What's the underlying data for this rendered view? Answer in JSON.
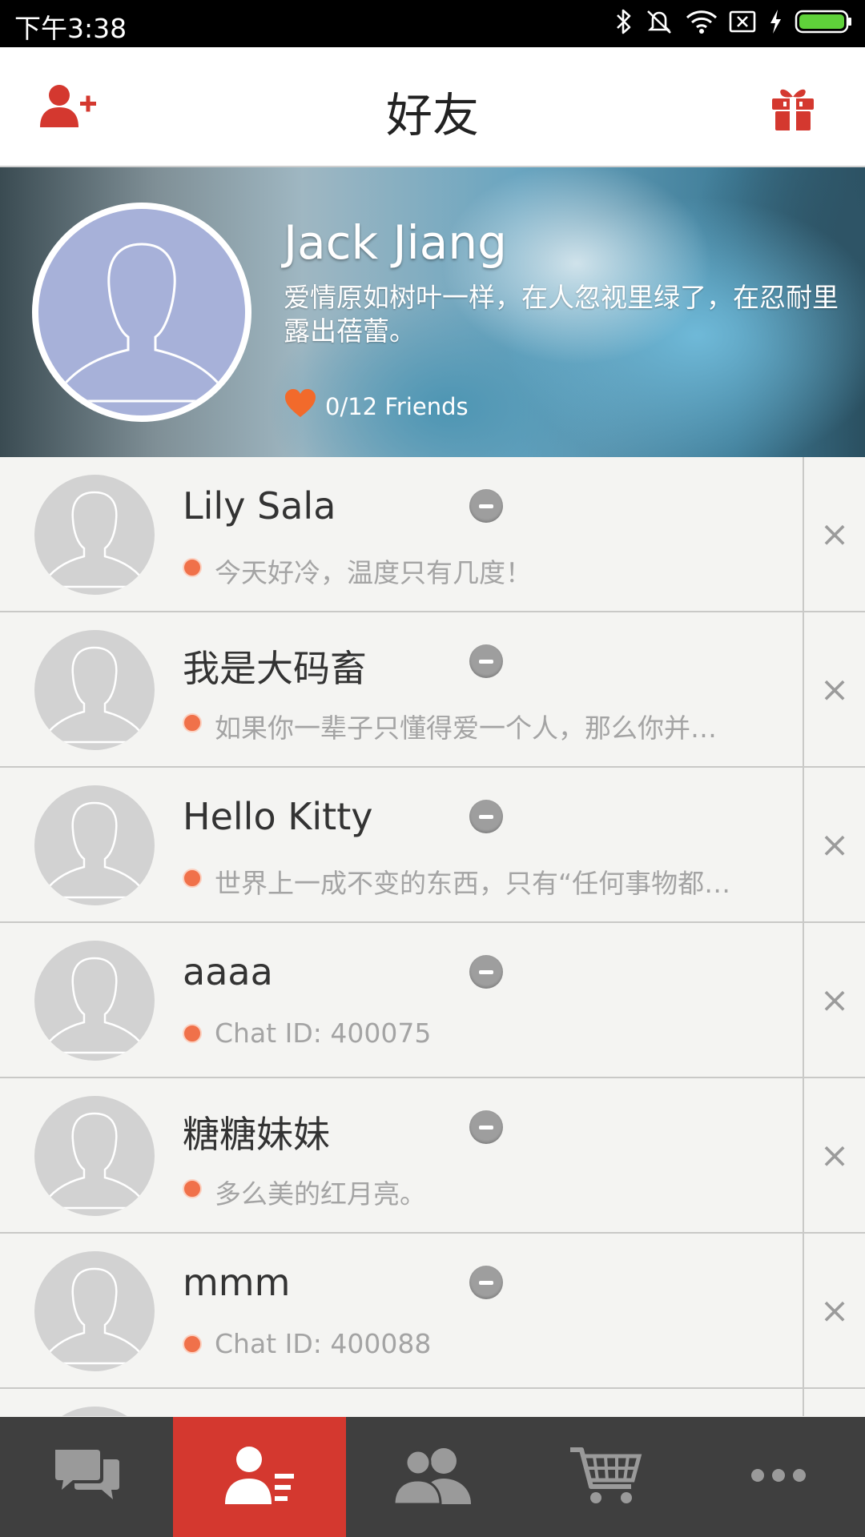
{
  "status_bar": {
    "time": "下午3:38"
  },
  "header": {
    "title": "好友"
  },
  "profile": {
    "name": "Jack Jiang",
    "signature": "爱情原如树叶一样，在人忽视里绿了，在忍耐里露出蓓蕾。",
    "friends_count": "0/12 Friends"
  },
  "friends": [
    {
      "name": "Lily Sala",
      "message": "今天好冷，温度只有几度！"
    },
    {
      "name": "我是大码畜",
      "message": "如果你一辈子只懂得爱一个人，那么你并…"
    },
    {
      "name": "Hello Kitty",
      "message": "世界上一成不变的东西，只有“任何事物都…"
    },
    {
      "name": "aaaa",
      "message": "Chat ID: 400075"
    },
    {
      "name": "糖糖妹妹",
      "message": "多么美的红月亮。"
    },
    {
      "name": "mmm",
      "message": "Chat ID: 400088"
    }
  ],
  "delete_glyph": "×",
  "bottom_nav": {
    "items": [
      "chat-icon",
      "contacts-icon",
      "group-icon",
      "cart-icon",
      "more-icon"
    ],
    "active_index": 1
  },
  "colors": {
    "accent": "#d4382f",
    "nav_bg": "#3f3f3f",
    "status_dot": "#f0714a",
    "avatar_profile": "#a7b1d9",
    "avatar_friend": "#d2d2d2"
  }
}
